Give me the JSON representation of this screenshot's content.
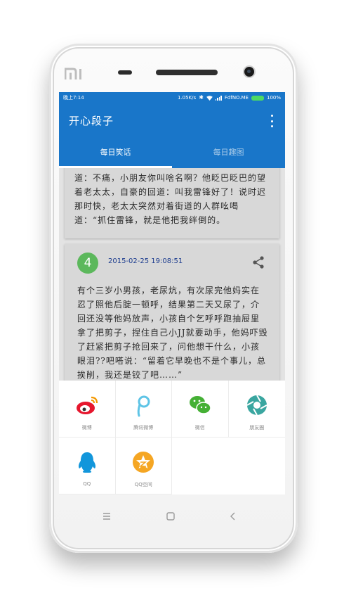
{
  "status_bar": {
    "time": "晚上7:14",
    "network_speed": "1.05K/s",
    "carrier": "FdfNO.ME",
    "battery": "100%"
  },
  "app_bar": {
    "title": "开心段子",
    "overflow_icon": "more-vert-icon"
  },
  "tabs": [
    {
      "label": "每日笑话",
      "active": true
    },
    {
      "label": "每日趣图",
      "active": false
    }
  ],
  "jokes": [
    {
      "text": "道：不痛，小朋友你叫啥名啊？他眨巴眨巴的望着老太太，自豪的回道：叫我雷锋好了！说时迟那时快，老太太突然对着街道的人群吆喝道：“抓住雷锋，就是他把我绊倒的。"
    },
    {
      "number": "4",
      "time": "2015-02-25 19:08:51",
      "text": "有个三岁小男孩，老尿炕，有次尿完他妈实在忍了照他后腚一顿呼，结果第二天又尿了，介回还没等他妈放声，小孩自个乞呼呼跑抽屉里拿了把剪子，捏住自己小JJ就要动手，他妈吓毁了赶紧把剪子抢回来了，问他想干什么，小孩眼泪??吧嗒说：“留着它早晚也不是个事儿，总挨削，我还是铰了吧……”"
    }
  ],
  "share_targets": [
    {
      "label": "微博",
      "icon": "weibo-icon",
      "color": "#e6162d"
    },
    {
      "label": "腾讯微博",
      "icon": "tencent-weibo-icon",
      "color": "#5ec4e6"
    },
    {
      "label": "微信",
      "icon": "wechat-icon",
      "color": "#45b035"
    },
    {
      "label": "朋友圈",
      "icon": "moments-icon",
      "color": "#3aa6a0"
    },
    {
      "label": "QQ",
      "icon": "qq-icon",
      "color": "#1296db"
    },
    {
      "label": "QQ空间",
      "icon": "qzone-icon",
      "color": "#f5a623"
    }
  ],
  "colors": {
    "primary": "#1976c9",
    "card": "#d8d8d8",
    "badge": "#5cb85c"
  }
}
